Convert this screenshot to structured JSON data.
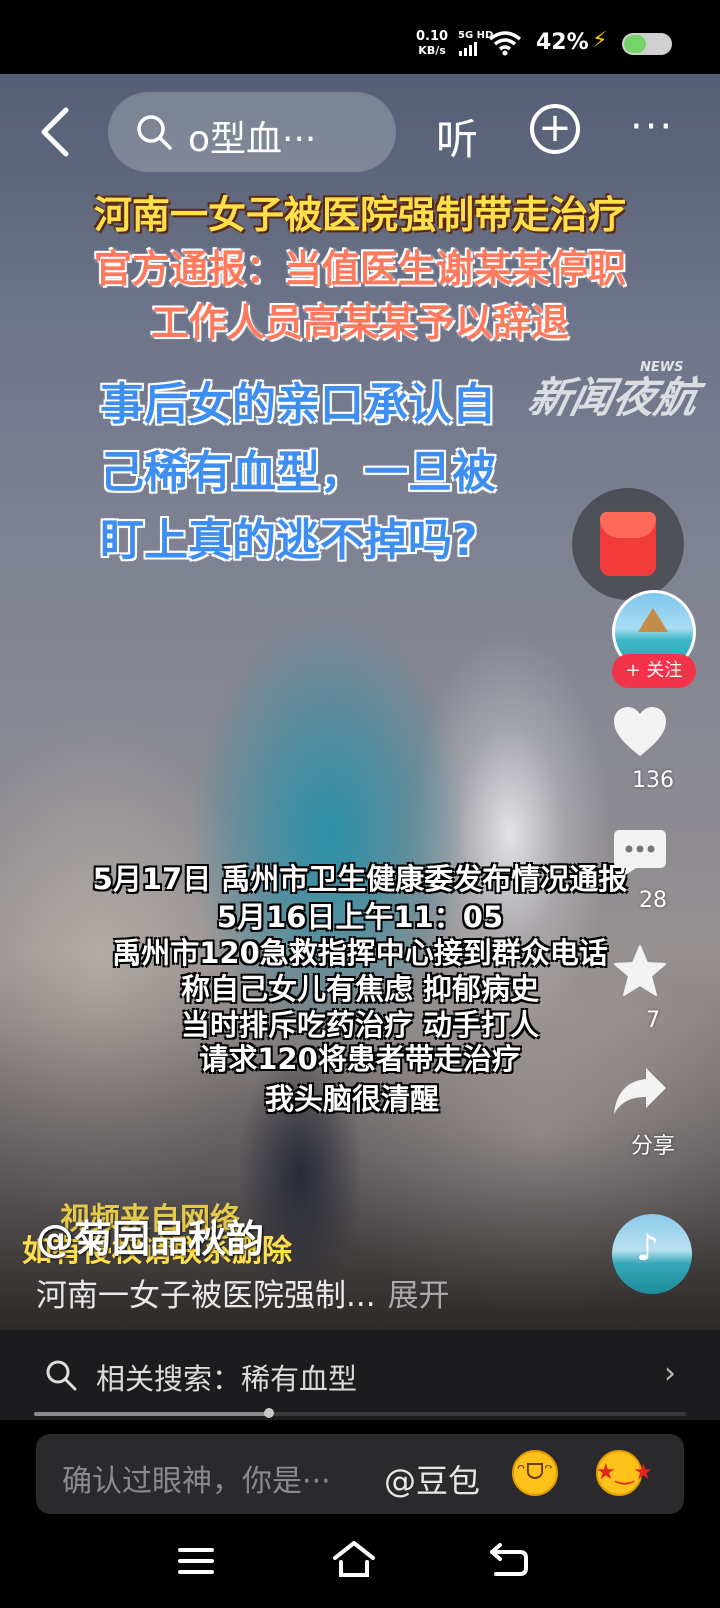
{
  "status_bar": {
    "net_speed_value": "0.10",
    "net_speed_unit": "KB/s",
    "network_type": "5G HD",
    "battery_percent": "42%"
  },
  "top_nav": {
    "search_query": "o型血···",
    "listen_label": "听",
    "add_icon": "plus-circle-icon",
    "more_icon": "ellipsis-icon"
  },
  "video": {
    "headline_line1": "河南一女子被医院强制带走治疗",
    "headline_line2": "官方通报：当值医生谢某某停职",
    "headline_line3": "工作人员高某某予以辞退",
    "question_line1": "事后女的亲口承认自",
    "question_line2": "己稀有血型，一旦被",
    "question_line3": "盯上真的逃不掉吗?",
    "news_logo": "新闻夜航",
    "news_logo_sup": "NEWS",
    "subtitle_lines": [
      "5月17日 禹州市卫生健康委发布情况通报",
      "5月16日上午11：05",
      "禹州市120急救指挥中心接到群众电话",
      "称自己女儿有焦虑 抑郁病史",
      "当时排斥吃药治疗 动手打人",
      "请求120将患者带走治疗",
      "我头脑很清醒"
    ],
    "watermark_line1": "视频来自网络",
    "watermark_line2": "如有侵权请联系删除"
  },
  "right_rail": {
    "follow_label": "+ 关注",
    "like_count": "136",
    "comment_count": "28",
    "favorite_count": "7",
    "share_label": "分享"
  },
  "post": {
    "author": "@菊园品秋韵",
    "description": "河南一女子被医院强制...",
    "expand_label": "展开"
  },
  "related_search": {
    "text": "相关搜索：稀有血型"
  },
  "playback": {
    "progress": 0.36
  },
  "comment_input": {
    "placeholder": "确认过眼神，你是···",
    "mention": "@豆包"
  },
  "colors": {
    "follow_red": "#f2344a",
    "headline_yellow": "#ffe04a",
    "question_blue": "#3e8ef2",
    "redpacket_red": "#f23b3b"
  }
}
